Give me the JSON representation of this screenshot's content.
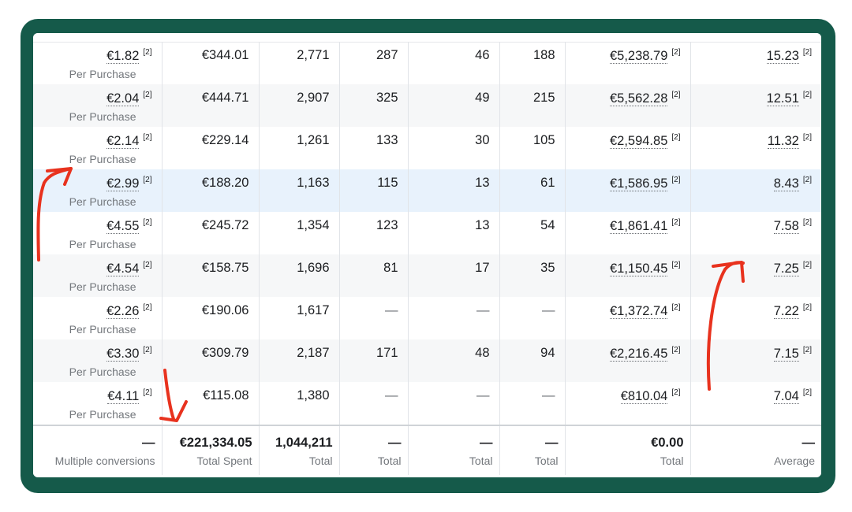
{
  "rows": [
    {
      "cost": "€1.82",
      "cost_sup": "[2]",
      "cost_sub": "Per Purchase",
      "spent": "€344.01",
      "c3": "2,771",
      "c4": "287",
      "c5": "46",
      "c6": "188",
      "value": "€5,238.79",
      "value_sup": "[2]",
      "roas": "15.23",
      "roas_sup": "[2]"
    },
    {
      "cost": "€2.04",
      "cost_sup": "[2]",
      "cost_sub": "Per Purchase",
      "spent": "€444.71",
      "c3": "2,907",
      "c4": "325",
      "c5": "49",
      "c6": "215",
      "value": "€5,562.28",
      "value_sup": "[2]",
      "roas": "12.51",
      "roas_sup": "[2]"
    },
    {
      "cost": "€2.14",
      "cost_sup": "[2]",
      "cost_sub": "Per Purchase",
      "spent": "€229.14",
      "c3": "1,261",
      "c4": "133",
      "c5": "30",
      "c6": "105",
      "value": "€2,594.85",
      "value_sup": "[2]",
      "roas": "11.32",
      "roas_sup": "[2]"
    },
    {
      "cost": "€2.99",
      "cost_sup": "[2]",
      "cost_sub": "Per Purchase",
      "spent": "€188.20",
      "c3": "1,163",
      "c4": "115",
      "c5": "13",
      "c6": "61",
      "value": "€1,586.95",
      "value_sup": "[2]",
      "roas": "8.43",
      "roas_sup": "[2]"
    },
    {
      "cost": "€4.55",
      "cost_sup": "[2]",
      "cost_sub": "Per Purchase",
      "spent": "€245.72",
      "c3": "1,354",
      "c4": "123",
      "c5": "13",
      "c6": "54",
      "value": "€1,861.41",
      "value_sup": "[2]",
      "roas": "7.58",
      "roas_sup": "[2]"
    },
    {
      "cost": "€4.54",
      "cost_sup": "[2]",
      "cost_sub": "Per Purchase",
      "spent": "€158.75",
      "c3": "1,696",
      "c4": "81",
      "c5": "17",
      "c6": "35",
      "value": "€1,150.45",
      "value_sup": "[2]",
      "roas": "7.25",
      "roas_sup": "[2]"
    },
    {
      "cost": "€2.26",
      "cost_sup": "[2]",
      "cost_sub": "Per Purchase",
      "spent": "€190.06",
      "c3": "1,617",
      "c4": "—",
      "c5": "—",
      "c6": "—",
      "value": "€1,372.74",
      "value_sup": "[2]",
      "roas": "7.22",
      "roas_sup": "[2]"
    },
    {
      "cost": "€3.30",
      "cost_sup": "[2]",
      "cost_sub": "Per Purchase",
      "spent": "€309.79",
      "c3": "2,187",
      "c4": "171",
      "c5": "48",
      "c6": "94",
      "value": "€2,216.45",
      "value_sup": "[2]",
      "roas": "7.15",
      "roas_sup": "[2]"
    },
    {
      "cost": "€4.11",
      "cost_sup": "[2]",
      "cost_sub": "Per Purchase",
      "spent": "€115.08",
      "c3": "1,380",
      "c4": "—",
      "c5": "—",
      "c6": "—",
      "value": "€810.04",
      "value_sup": "[2]",
      "roas": "7.04",
      "roas_sup": "[2]"
    }
  ],
  "totals": [
    {
      "value": "—",
      "label": "Multiple conversions"
    },
    {
      "value": "€221,334.05",
      "label": "Total Spent"
    },
    {
      "value": "1,044,211",
      "label": "Total"
    },
    {
      "value": "—",
      "label": "Total"
    },
    {
      "value": "—",
      "label": "Total"
    },
    {
      "value": "—",
      "label": "Total"
    },
    {
      "value": "€0.00",
      "label": "Total"
    },
    {
      "value": "—",
      "label": "Average"
    }
  ],
  "colors": {
    "frame": "#155a4a",
    "highlight_row": "#e8f2fc",
    "alt_row": "#f6f7f8",
    "annotation_arrow": "#e8321e"
  }
}
